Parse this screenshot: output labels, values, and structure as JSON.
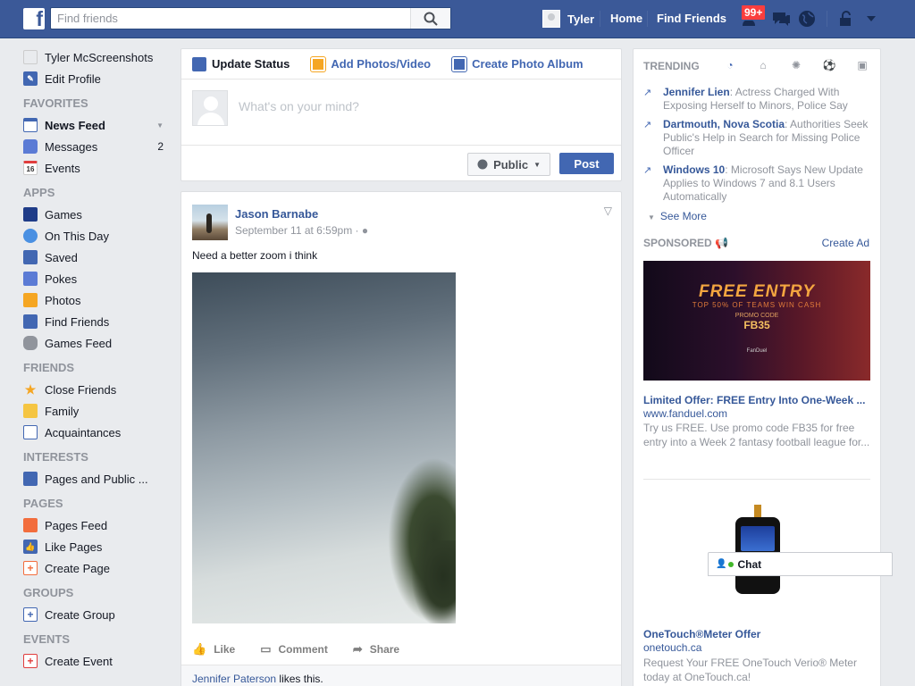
{
  "topbar": {
    "logo_letter": "f",
    "search_placeholder": "Find friends",
    "user_name": "Tyler",
    "home_label": "Home",
    "find_friends_label": "Find Friends",
    "notification_badge": "99+",
    "brand_color": "#3b5998"
  },
  "leftnav": {
    "profile_name": "Tyler McScreenshots",
    "edit_profile": "Edit Profile",
    "sections": {
      "favorites": "FAVORITES",
      "apps": "APPS",
      "friends": "FRIENDS",
      "interests": "INTERESTS",
      "pages": "PAGES",
      "groups": "GROUPS",
      "events": "EVENTS"
    },
    "favorites": [
      {
        "label": "News Feed",
        "icon": "news-feed-icon"
      },
      {
        "label": "Messages",
        "icon": "messages-icon",
        "count": "2"
      },
      {
        "label": "Events",
        "icon": "calendar-icon",
        "badge": "16"
      }
    ],
    "apps": [
      {
        "label": "Games",
        "icon": "games-icon"
      },
      {
        "label": "On This Day",
        "icon": "clock-icon"
      },
      {
        "label": "Saved",
        "icon": "bookmark-icon"
      },
      {
        "label": "Pokes",
        "icon": "poke-icon"
      },
      {
        "label": "Photos",
        "icon": "photos-icon"
      },
      {
        "label": "Find Friends",
        "icon": "find-friends-icon"
      },
      {
        "label": "Games Feed",
        "icon": "controller-icon"
      }
    ],
    "friends": [
      {
        "label": "Close Friends",
        "icon": "star-icon"
      },
      {
        "label": "Family",
        "icon": "family-icon"
      },
      {
        "label": "Acquaintances",
        "icon": "acquaintances-icon"
      }
    ],
    "interests": [
      {
        "label": "Pages and Public ...",
        "icon": "pages-public-icon"
      }
    ],
    "pages": [
      {
        "label": "Pages Feed",
        "icon": "flag-icon"
      },
      {
        "label": "Like Pages",
        "icon": "thumbs-up-icon"
      },
      {
        "label": "Create Page",
        "icon": "plus-icon"
      }
    ],
    "groups": [
      {
        "label": "Create Group",
        "icon": "plus-icon"
      }
    ],
    "events": [
      {
        "label": "Create Event",
        "icon": "plus-icon"
      }
    ]
  },
  "composer": {
    "tabs": [
      {
        "label": "Update Status",
        "icon": "pencil-icon"
      },
      {
        "label": "Add Photos/Video",
        "icon": "photo-icon"
      },
      {
        "label": "Create Photo Album",
        "icon": "album-icon"
      }
    ],
    "placeholder": "What's on your mind?",
    "privacy": "Public",
    "post_label": "Post"
  },
  "post": {
    "author": "Jason Barnabe",
    "time": "September 11 at 6:59pm ·",
    "text": "Need a better zoom i think",
    "actions": [
      "Like",
      "Comment",
      "Share"
    ],
    "liker": "Jennifer Paterson",
    "likes_suffix": " likes this."
  },
  "trending": {
    "header": "TRENDING",
    "items": [
      {
        "name": "Jennifer Lien",
        "desc": ": Actress Charged With Exposing Herself to Minors, Police Say"
      },
      {
        "name": "Dartmouth, Nova Scotia",
        "desc": ": Authorities Seek Public's Help in Search for Missing Police Officer"
      },
      {
        "name": "Windows 10",
        "desc": ": Microsoft Says New Update Applies to Windows 7 and 8.1 Users Automatically"
      }
    ],
    "see_more": "See More"
  },
  "sponsored": {
    "header": "SPONSORED",
    "create_ad": "Create Ad",
    "ad1": {
      "image_headline": "FREE ENTRY",
      "image_sub": "TOP 50% OF TEAMS WIN CASH",
      "image_promo": "PROMO CODE",
      "image_code": "FB35",
      "image_brand": "FanDuel",
      "title": "Limited Offer: FREE Entry Into One-Week ...",
      "url": "www.fanduel.com",
      "desc": "Try us FREE. Use promo code FB35 for free entry into a Week 2 fantasy football league for..."
    },
    "ad2": {
      "title": "OneTouch®Meter Offer",
      "url": "onetouch.ca",
      "desc": "Request Your FREE OneTouch Verio® Meter today at OneTouch.ca!"
    }
  },
  "chat": {
    "label": "Chat"
  }
}
